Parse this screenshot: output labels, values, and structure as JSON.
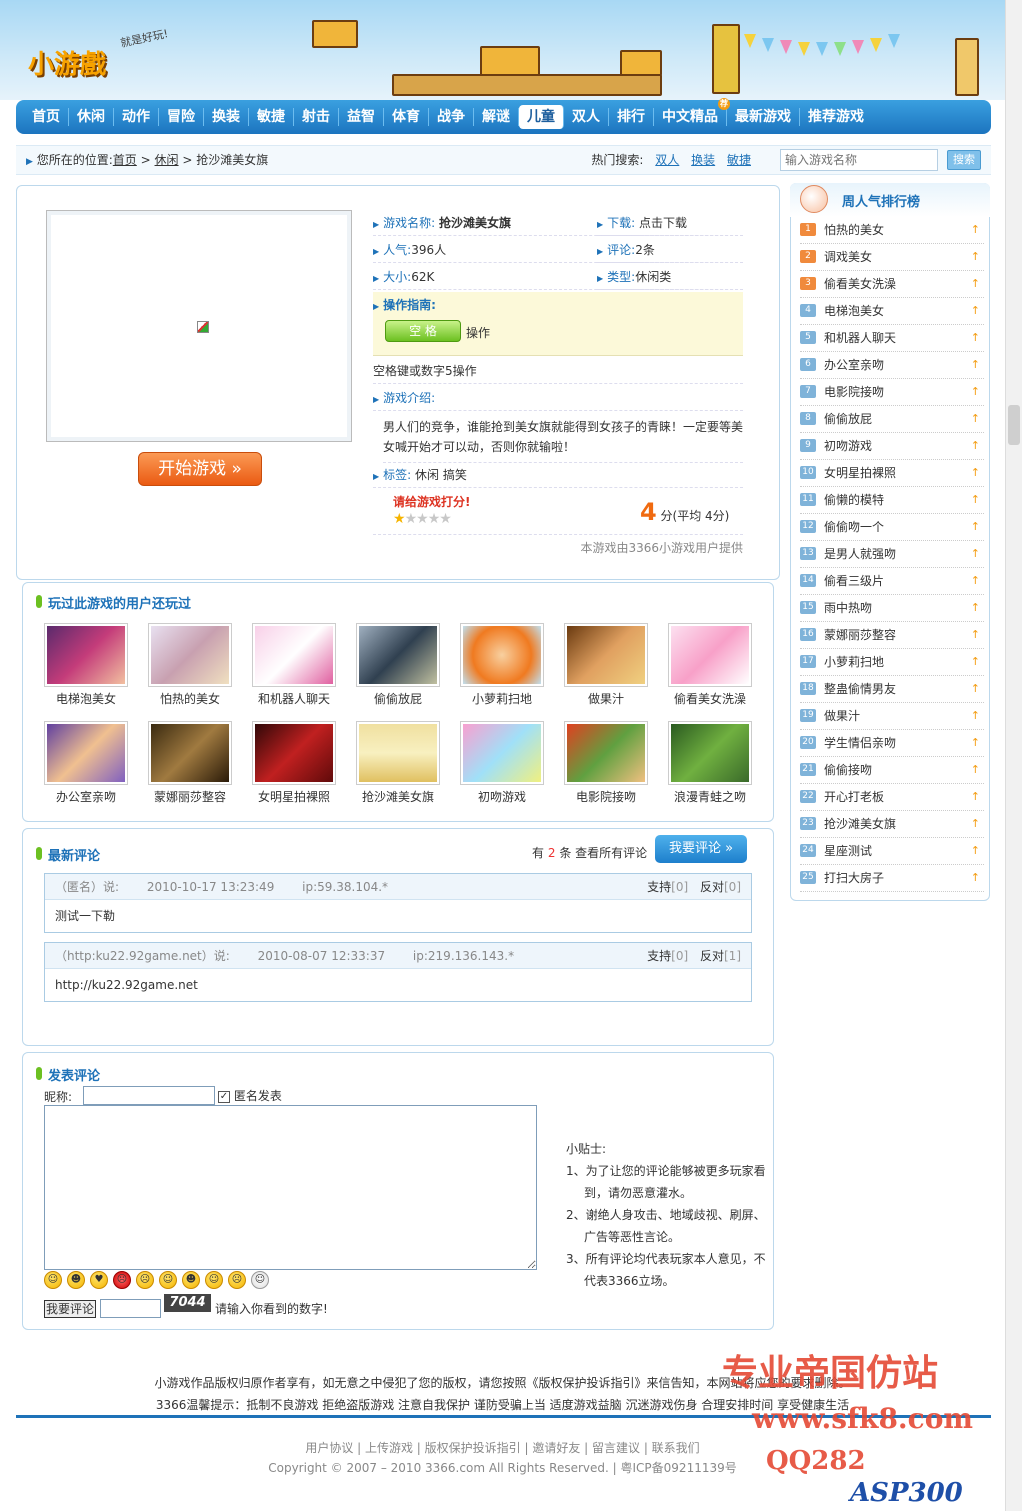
{
  "header": {
    "logo": "小游戲",
    "slogan": "就是好玩!"
  },
  "nav": {
    "items": [
      "首页",
      "休闲",
      "动作",
      "冒险",
      "换装",
      "敏捷",
      "射击",
      "益智",
      "体育",
      "战争",
      "解谜",
      "儿童",
      "双人",
      "排行",
      "中文精品",
      "最新游戏",
      "推荐游戏"
    ],
    "active": "儿童",
    "badge": "荐"
  },
  "crumb": {
    "prefix": "您所在的位置:",
    "home": "首页",
    "sep": ">",
    "cat": "休闲",
    "game": "抢沙滩美女旗",
    "hot_label": "热门搜索:",
    "hot": [
      "双人",
      "换装",
      "敏捷"
    ],
    "search_placeholder": "输入游戏名称",
    "search_btn": "搜索"
  },
  "game": {
    "start": "开始游戏 »",
    "name_label": "游戏名称:",
    "name": "抢沙滩美女旗",
    "dl_label": "下载:",
    "dl": "点击下载",
    "pop_label": "人气:",
    "pop": "396人",
    "cmt_label": "评论:",
    "cmt": "2条",
    "size_label": "大小:",
    "size": "62K",
    "type_label": "类型:",
    "type": "休闲类",
    "guide_label": "操作指南:",
    "key": "空 格",
    "key_desc": "操作",
    "note": "空格键或数字5操作",
    "intro_label": "游戏介绍:",
    "intro": "男人们的竞争，谁能抢到美女旗就能得到女孩子的青睐！一定要等美女喊开始才可以动，否则你就输啦！",
    "tag_label": "标签:",
    "tags": "休闲 搞笑",
    "rate_prompt": "请给游戏打分!",
    "score": "4",
    "score_unit": "分(平均 4分)",
    "provider": "本游戏由3366小游戏用户提供"
  },
  "also": {
    "title": "玩过此游戏的用户还玩过",
    "items": [
      "电梯泡美女",
      "怕热的美女",
      "和机器人聊天",
      "偷偷放屁",
      "小萝莉扫地",
      "做果汁",
      "偷看美女洗澡",
      "办公室亲吻",
      "蒙娜丽莎整容",
      "女明星拍裸照",
      "抢沙滩美女旗",
      "初吻游戏",
      "电影院接吻",
      "浪漫青蛙之吻"
    ]
  },
  "comments": {
    "title": "最新评论",
    "count_pre": "有",
    "count": "2",
    "count_post": "条 查看所有评论",
    "btn": "我要评论 »",
    "support": "支持",
    "against": "反对",
    "list": [
      {
        "user": "（匿名）说:",
        "time": "2010-10-17 13:23:49",
        "ip": "ip:59.38.104.*",
        "sup": "[0]",
        "ag": "[0]",
        "text": "测试一下勒"
      },
      {
        "user": "（http:ku22.92game.net）说:",
        "time": "2010-08-07 12:33:37",
        "ip": "ip:219.136.143.*",
        "sup": "[0]",
        "ag": "[1]",
        "text": "http://ku22.92game.net"
      }
    ]
  },
  "post": {
    "title": "发表评论",
    "nick_label": "昵称:",
    "anon": "匿名发表",
    "submit": "我要评论",
    "captcha": "7044",
    "captcha_hint": "请输入你看到的数字!",
    "tips_title": "小贴士:",
    "tips": [
      "1、为了让您的评论能够被更多玩家看到，请勿恶意灌水。",
      "2、谢绝人身攻击、地域歧视、刷屏、广告等恶性言论。",
      "3、所有评论均代表玩家本人意见，不代表3366立场。"
    ]
  },
  "rank": {
    "title": "周人气排行榜",
    "items": [
      "怕热的美女",
      "调戏美女",
      "偷看美女洗澡",
      "电梯泡美女",
      "和机器人聊天",
      "办公室亲吻",
      "电影院接吻",
      "偷偷放屁",
      "初吻游戏",
      "女明星拍裸照",
      "偷懒的模特",
      "偷偷吻一个",
      "是男人就强吻",
      "偷看三级片",
      "雨中热吻",
      "蒙娜丽莎整容",
      "小萝莉扫地",
      "整蛊偷情男友",
      "做果汁",
      "学生情侣亲吻",
      "偷偷接吻",
      "开心打老板",
      "抢沙滩美女旗",
      "星座测试",
      "打扫大房子"
    ]
  },
  "footer": {
    "line1": "小游戏作品版权归原作者享有，如无意之中侵犯了您的版权，请您按照《版权保护投诉指引》来信告知，本网站将应您的要求删除。",
    "line2": "3366温馨提示：抵制不良游戏 拒绝盗版游戏 注意自我保护 谨防受骗上当 适度游戏益脑 沉迷游戏伤身 合理安排时间 享受健康生活",
    "links": "用户协议 | 上传游戏 | 版权保护投诉指引 | 邀请好友 | 留言建议 | 联系我们",
    "copy": "Copyright © 2007 – 2010 3366.com All Rights Reserved. | 粤ICP备09211139号"
  },
  "watermark": {
    "w1": "专业帝国仿站",
    "w2": "www.sfk8.com",
    "w3": "QQ282",
    "w4": "ASP300"
  }
}
